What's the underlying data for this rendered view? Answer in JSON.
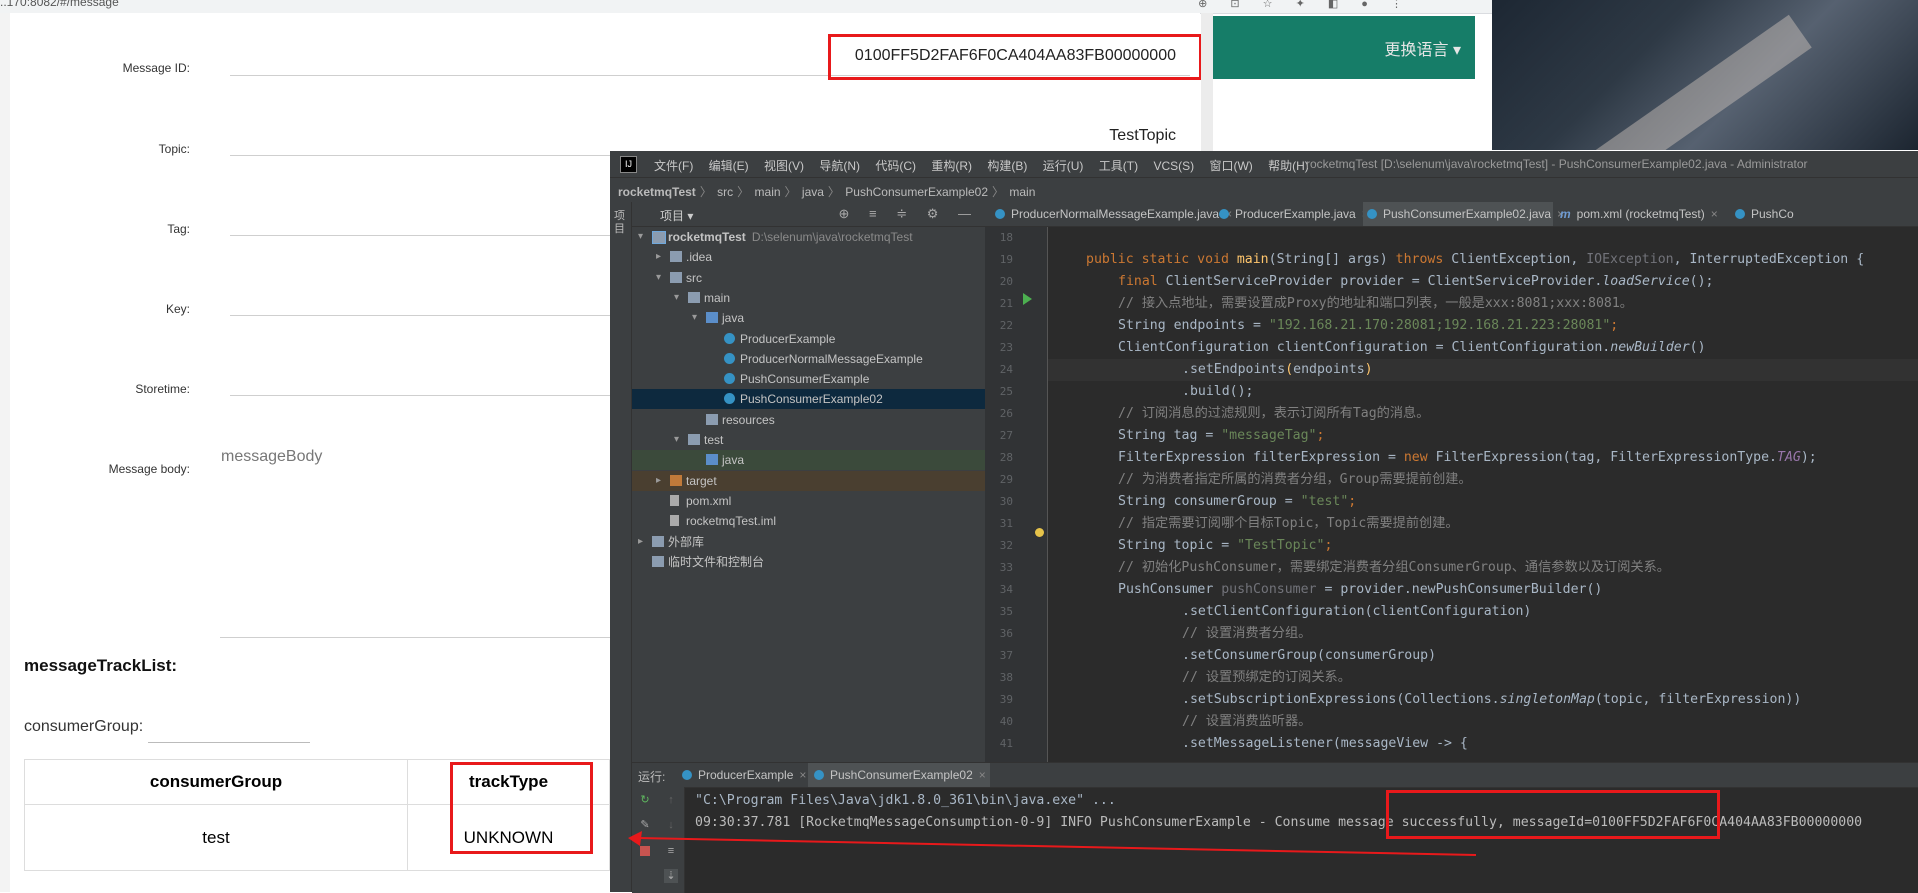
{
  "browser": {
    "url": "..170:8082/#/message",
    "toolbar_icons": "⊕ ⊡ ☆ ✦ ◧ ● ⋮",
    "fields": [
      {
        "label": "Message ID:",
        "value": "0100FF5D2FAF6F0CA404AA83FB00000000"
      },
      {
        "label": "Topic:",
        "value": "TestTopic"
      },
      {
        "label": "Tag:",
        "value": ""
      },
      {
        "label": "Key:",
        "value": ""
      },
      {
        "label": "Storetime:",
        "value": ""
      },
      {
        "label": "Message body:",
        "value": "messageBody"
      }
    ],
    "track_title": "messageTrackList:",
    "consumer_group_label": "consumerGroup:",
    "table": {
      "headers": [
        "consumerGroup",
        "trackType"
      ],
      "rows": [
        [
          "test",
          "UNKNOWN"
        ]
      ]
    },
    "lang_switch": "更换语言 ▾"
  },
  "ide": {
    "logo": "IJ",
    "menu": [
      "文件(F)",
      "编辑(E)",
      "视图(V)",
      "导航(N)",
      "代码(C)",
      "重构(R)",
      "构建(B)",
      "运行(U)",
      "工具(T)",
      "VCS(S)",
      "窗口(W)",
      "帮助(H)"
    ],
    "title": "rocketmqTest [D:\\selenum\\java\\rocketmqTest] - PushConsumerExample02.java - Administrator",
    "breadcrumb": [
      "rocketmqTest",
      "src",
      "main",
      "java",
      "PushConsumerExample02",
      "main"
    ],
    "left_strip_label": "项目",
    "project_panel": {
      "title": "项目 ▾",
      "tools": "⊕ ≡ ≑ ⚙ —",
      "tree": [
        {
          "arrow": "▾",
          "icon": "module",
          "label": "rocketmqTest",
          "path": "D:\\selenum\\java\\rocketmqTest",
          "depth": 0,
          "bold": true
        },
        {
          "arrow": "▸",
          "icon": "folder",
          "label": ".idea",
          "depth": 1
        },
        {
          "arrow": "▾",
          "icon": "folder",
          "label": "src",
          "depth": 1
        },
        {
          "arrow": "▾",
          "icon": "folder",
          "label": "main",
          "depth": 2
        },
        {
          "arrow": "▾",
          "icon": "folder-blue",
          "label": "java",
          "depth": 3
        },
        {
          "arrow": "",
          "icon": "class",
          "label": "ProducerExample",
          "depth": 4
        },
        {
          "arrow": "",
          "icon": "class",
          "label": "ProducerNormalMessageExample",
          "depth": 4
        },
        {
          "arrow": "",
          "icon": "class",
          "label": "PushConsumerExample",
          "depth": 4
        },
        {
          "arrow": "",
          "icon": "class",
          "label": "PushConsumerExample02",
          "depth": 4,
          "selected": true
        },
        {
          "arrow": "",
          "icon": "folder",
          "label": "resources",
          "depth": 3
        },
        {
          "arrow": "▾",
          "icon": "folder",
          "label": "test",
          "depth": 2
        },
        {
          "arrow": "",
          "icon": "folder-green",
          "label": "java",
          "depth": 3,
          "greenish": true
        },
        {
          "arrow": "▸",
          "icon": "folder-orange",
          "label": "target",
          "depth": 1,
          "brownish": true
        },
        {
          "arrow": "",
          "icon": "file",
          "label": "pom.xml",
          "depth": 1
        },
        {
          "arrow": "",
          "icon": "file",
          "label": "rocketmqTest.iml",
          "depth": 1
        },
        {
          "arrow": "▸",
          "icon": "lib",
          "label": "外部库",
          "depth": 0
        },
        {
          "arrow": "",
          "icon": "scratch",
          "label": "临时文件和控制台",
          "depth": 0
        }
      ]
    },
    "editor_tabs": [
      {
        "label": "ProducerNormalMessageExample.java",
        "kind": "class"
      },
      {
        "label": "ProducerExample.java",
        "kind": "class"
      },
      {
        "label": "PushConsumerExample02.java",
        "kind": "class",
        "active": true
      },
      {
        "label": "pom.xml (rocketmqTest)",
        "kind": "maven"
      },
      {
        "label": "PushCo",
        "kind": "class"
      }
    ],
    "line_numbers": [
      "18",
      "19",
      "20",
      "21",
      "22",
      "23",
      "24",
      "25",
      "26",
      "27",
      "28",
      "29",
      "30",
      "31",
      "32",
      "33",
      "34",
      "35",
      "36",
      "37",
      "38",
      "39",
      "40",
      "41"
    ],
    "code": {
      "l19_a": "public static void ",
      "l19_b": "main",
      "l19_c": "(String[] args) ",
      "l19_d": "throws ",
      "l19_e": "ClientException, ",
      "l19_f": "IOException",
      "l19_g": ", InterruptedException {",
      "l20_a": "final ",
      "l20_b": "ClientServiceProvider provider = ClientServiceProvider.",
      "l20_c": "loadService",
      "l20_d": "();",
      "l21": "// 接入点地址，需要设置成Proxy的地址和端口列表，一般是xxx:8081;xxx:8081。",
      "l22_a": "String endpoints = ",
      "l22_b": "\"192.168.21.170:28081;192.168.21.223:28081\"",
      "l22_c": ";",
      "l23_a": "ClientConfiguration clientConfiguration = ClientConfiguration.",
      "l23_b": "newBuilder",
      "l23_c": "()",
      "l24_a": ".setEndpoints",
      "l24_b": "(",
      "l24_c": "endpoints",
      "l24_d": ")",
      "l25": ".build();",
      "l26": "// 订阅消息的过滤规则，表示订阅所有Tag的消息。",
      "l27_a": "String tag = ",
      "l27_b": "\"messageTag\"",
      "l27_c": ";",
      "l28_a": "FilterExpression filterExpression = ",
      "l28_b": "new ",
      "l28_c": "FilterExpression(tag, FilterExpressionType.",
      "l28_d": "TAG",
      "l28_e": ");",
      "l29": "// 为消费者指定所属的消费者分组，Group需要提前创建。",
      "l30_a": "String consumerGroup = ",
      "l30_b": "\"test\"",
      "l30_c": ";",
      "l31": "// 指定需要订阅哪个目标Topic，Topic需要提前创建。",
      "l32_a": "String topic = ",
      "l32_b": "\"TestTopic\"",
      "l32_c": ";",
      "l33": "// 初始化PushConsumer，需要绑定消费者分组ConsumerGroup、通信参数以及订阅关系。",
      "l34_a": "PushConsumer ",
      "l34_b": "pushConsumer",
      "l34_c": " = provider.newPushConsumerBuilder()",
      "l35": ".setClientConfiguration(clientConfiguration)",
      "l36": "// 设置消费者分组。",
      "l37": ".setConsumerGroup(consumerGroup)",
      "l38": "// 设置预绑定的订阅关系。",
      "l39_a": ".setSubscriptionExpressions(Collections.",
      "l39_b": "singletonMap",
      "l39_c": "(topic, filterExpression))",
      "l40": "// 设置消费监听器。",
      "l41": ".setMessageListener(messageView -> {"
    },
    "run_panel": {
      "label": "运行:",
      "tabs": [
        {
          "label": "ProducerExample"
        },
        {
          "label": "PushConsumerExample02",
          "active": true
        }
      ],
      "console": [
        "\"C:\\Program Files\\Java\\jdk1.8.0_361\\bin\\java.exe\" ...",
        "09:30:37.781 [RocketmqMessageConsumption-0-9] INFO PushConsumerExample - Consume message successfully, messageId=0100FF5D2FAF6F0CA404AA83FB00000000"
      ]
    }
  },
  "colors": {
    "highlight_red": "#e8191b",
    "header_green": "#167d68",
    "ide_bg": "#2b2b2b"
  }
}
